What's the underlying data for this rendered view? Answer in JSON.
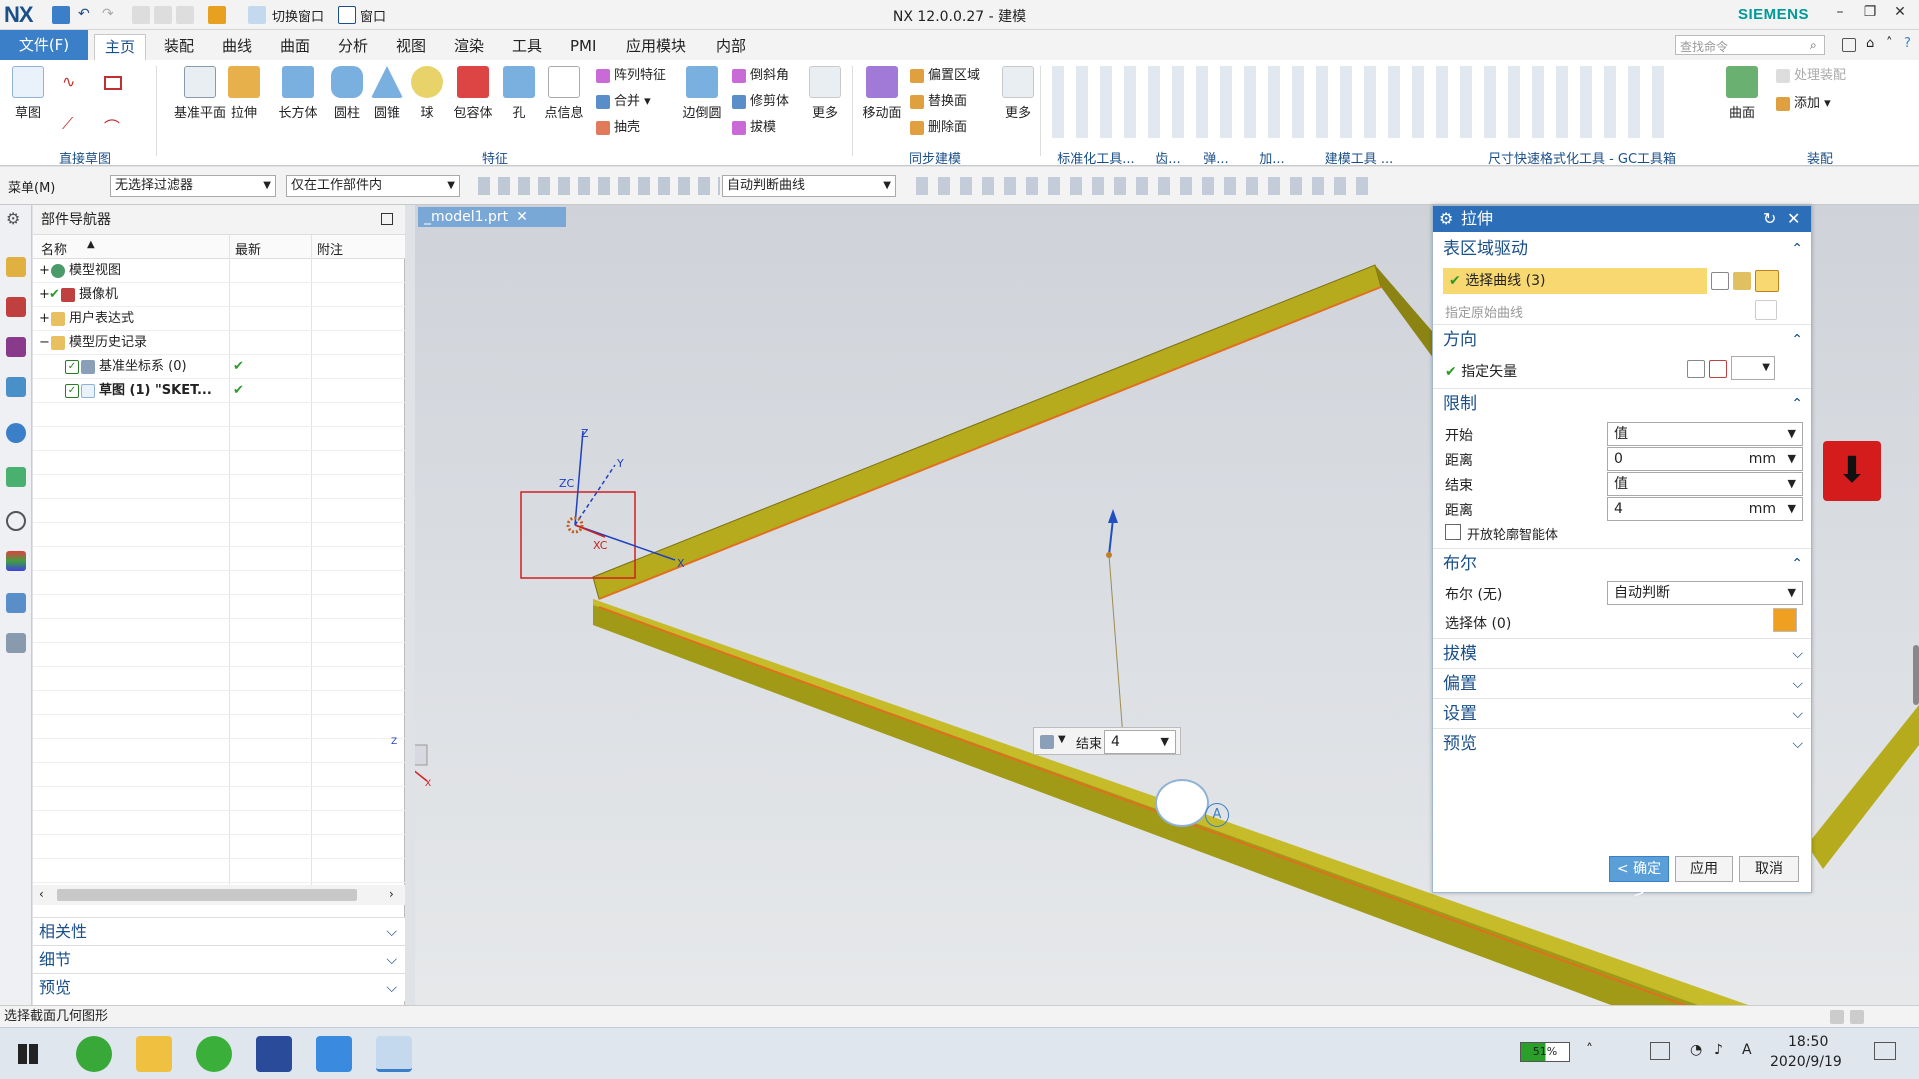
{
  "app": {
    "logo": "NX",
    "title": "NX 12.0.0.27 - 建模",
    "brand": "SIEMENS",
    "switch_window": "切换窗口",
    "window_menu": "窗口"
  },
  "tabs": {
    "file": "文件(F)",
    "items": [
      "主页",
      "装配",
      "曲线",
      "曲面",
      "分析",
      "视图",
      "渲染",
      "工具",
      "PMI",
      "应用模块",
      "内部"
    ],
    "search_placeholder": "查找命令"
  },
  "ribbon": {
    "sketch": {
      "label": "草图",
      "group": "直接草图"
    },
    "feature_buttons": [
      "基准平面",
      "拉伸",
      "长方体",
      "圆柱",
      "圆锥",
      "球",
      "包容体",
      "孔",
      "点信息"
    ],
    "feature_small": [
      "阵列特征",
      "合并",
      "抽壳",
      "边倒圆",
      "倒斜角",
      "修剪体",
      "拔模",
      "更多"
    ],
    "feature_group": "特征",
    "sync_buttons": [
      "移动面",
      "偏置区域",
      "替换面",
      "删除面",
      "更多"
    ],
    "sync_group": "同步建模",
    "group_labels": [
      "标准化工具...",
      "齿...",
      "弹...",
      "加...",
      "建模工具 ...",
      "尺寸快速格式化工具 - GC工具箱",
      "装配"
    ],
    "surface": "曲面",
    "add": "添加",
    "process_assembly": "处理装配"
  },
  "filterbar": {
    "menu": "菜单(M)",
    "filter": "无选择过滤器",
    "scope": "仅在工作部件内",
    "curve_rule": "自动判断曲线"
  },
  "navigator": {
    "title": "部件导航器",
    "columns": [
      "名称",
      "最新",
      "附注"
    ],
    "rows": [
      {
        "label": "模型视图",
        "indent": 0,
        "latest": ""
      },
      {
        "label": "摄像机",
        "indent": 0,
        "latest": ""
      },
      {
        "label": "用户表达式",
        "indent": 0,
        "latest": ""
      },
      {
        "label": "模型历史记录",
        "indent": 0,
        "latest": ""
      },
      {
        "label": "基准坐标系 (0)",
        "indent": 1,
        "latest": "✔"
      },
      {
        "label": "草图 (1) \"SKET...",
        "indent": 1,
        "latest": "✔"
      }
    ],
    "sections": [
      "相关性",
      "细节",
      "预览"
    ]
  },
  "viewport": {
    "tab": "_model1.prt",
    "axis_labels": {
      "z": "Z",
      "zc": "ZC",
      "y": "Y",
      "xc": "XC",
      "x": "X"
    },
    "triad": {
      "z": "Z",
      "x": "X"
    },
    "float_end_label": "结束",
    "float_end_value": "4"
  },
  "dialog": {
    "title": "拉伸",
    "sec_profile": "表区域驱动",
    "select_curve": "选择曲线 (3)",
    "origin_curve": "指定原始曲线",
    "sec_direction": "方向",
    "vector": "指定矢量",
    "sec_limits": "限制",
    "start_label": "开始",
    "start_value": "值",
    "distance_label": "距离",
    "start_distance": "0",
    "unit": "mm",
    "end_label": "结束",
    "end_value": "值",
    "end_distance": "4",
    "open_profile": "开放轮廓智能体",
    "sec_boolean": "布尔",
    "boolean_label": "布尔 (无)",
    "boolean_value": "自动判断",
    "select_body": "选择体 (0)",
    "collapsed": [
      "拔模",
      "偏置",
      "设置",
      "预览"
    ],
    "ok": "< 确定 >",
    "apply": "应用",
    "cancel": "取消"
  },
  "status": {
    "text": "选择截面几何图形"
  },
  "taskbar": {
    "battery": "51%",
    "time": "18:50",
    "date": "2020/9/19"
  }
}
